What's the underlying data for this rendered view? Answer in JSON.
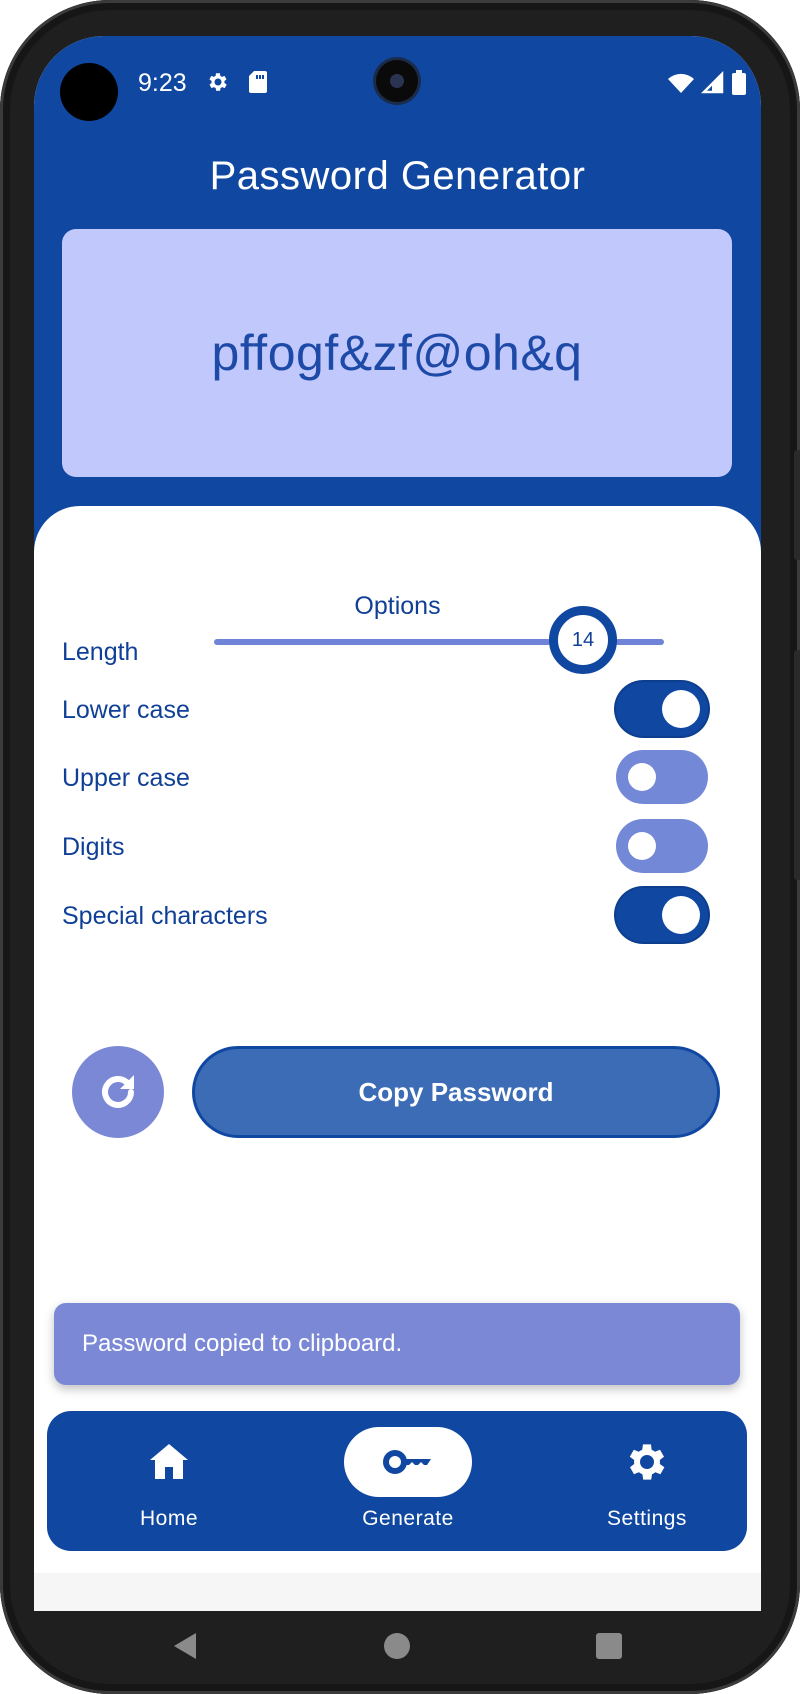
{
  "status": {
    "time": "9:23",
    "icons_left": [
      "settings-icon",
      "sd-card-icon"
    ],
    "icons_right": [
      "wifi-icon",
      "cell-signal-icon",
      "battery-icon"
    ]
  },
  "header": {
    "title": "Password Generator"
  },
  "password": {
    "value": "pffogf&zf@oh&q"
  },
  "options": {
    "title": "Options",
    "length": {
      "label": "Length",
      "value": "14",
      "fraction": 0.82
    },
    "toggles": [
      {
        "label": "Lower case",
        "checked": true
      },
      {
        "label": "Upper case",
        "checked": false
      },
      {
        "label": "Digits",
        "checked": false
      },
      {
        "label": "Special characters",
        "checked": true
      }
    ]
  },
  "actions": {
    "copy_label": "Copy Password",
    "refresh_icon": "refresh-icon"
  },
  "snackbar": {
    "text": "Password copied to clipboard."
  },
  "bottom_nav": {
    "items": [
      {
        "label": "Home",
        "icon": "home-icon",
        "active": false
      },
      {
        "label": "Generate",
        "icon": "key-icon",
        "active": true
      },
      {
        "label": "Settings",
        "icon": "settings-icon",
        "active": false
      }
    ]
  },
  "colors": {
    "primary": "#0f47a1",
    "card": "#c1c8fc",
    "secondary": "#7b88d6",
    "copy_button": "#3b6cb5"
  }
}
